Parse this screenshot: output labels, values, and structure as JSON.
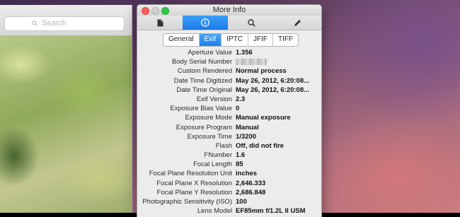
{
  "background_window": {
    "search_placeholder": "Search"
  },
  "window": {
    "title": "More Info",
    "toolbar_icons": [
      "document-icon",
      "info-icon",
      "magnifier-icon",
      "pencil-icon"
    ],
    "accent_color": "#1b7be6",
    "tabs": [
      {
        "label": "General",
        "selected": false
      },
      {
        "label": "Exif",
        "selected": true
      },
      {
        "label": "IPTC",
        "selected": false
      },
      {
        "label": "JFIF",
        "selected": false
      },
      {
        "label": "TIFF",
        "selected": false
      }
    ],
    "rows": [
      {
        "key": "Aperture Value",
        "value": "1.356"
      },
      {
        "key": "Body Serial Number",
        "value": ""
      },
      {
        "key": "Custom Rendered",
        "value": "Normal process"
      },
      {
        "key": "Date Time Digitized",
        "value": "May 26, 2012, 6:20:08..."
      },
      {
        "key": "Date Time Original",
        "value": "May 26, 2012, 6:20:08..."
      },
      {
        "key": "Exif Version",
        "value": "2.3"
      },
      {
        "key": "Exposure Bias Value",
        "value": "0"
      },
      {
        "key": "Exposure Mode",
        "value": "Manual exposure"
      },
      {
        "key": "Exposure Program",
        "value": "Manual"
      },
      {
        "key": "Exposure Time",
        "value": "1/3200"
      },
      {
        "key": "Flash",
        "value": "Off, did not fire"
      },
      {
        "key": "FNumber",
        "value": "1.6"
      },
      {
        "key": "Focal Length",
        "value": "85"
      },
      {
        "key": "Focal Plane Resolution Unit",
        "value": "inches"
      },
      {
        "key": "Focal Plane X Resolution",
        "value": "2,646.333"
      },
      {
        "key": "Focal Plane Y Resolution",
        "value": "2,686.848"
      },
      {
        "key": "Photographic Sensitivity (ISO)",
        "value": "100"
      },
      {
        "key": "Lens Model",
        "value": "EF85mm f/1.2L II USM"
      }
    ]
  }
}
